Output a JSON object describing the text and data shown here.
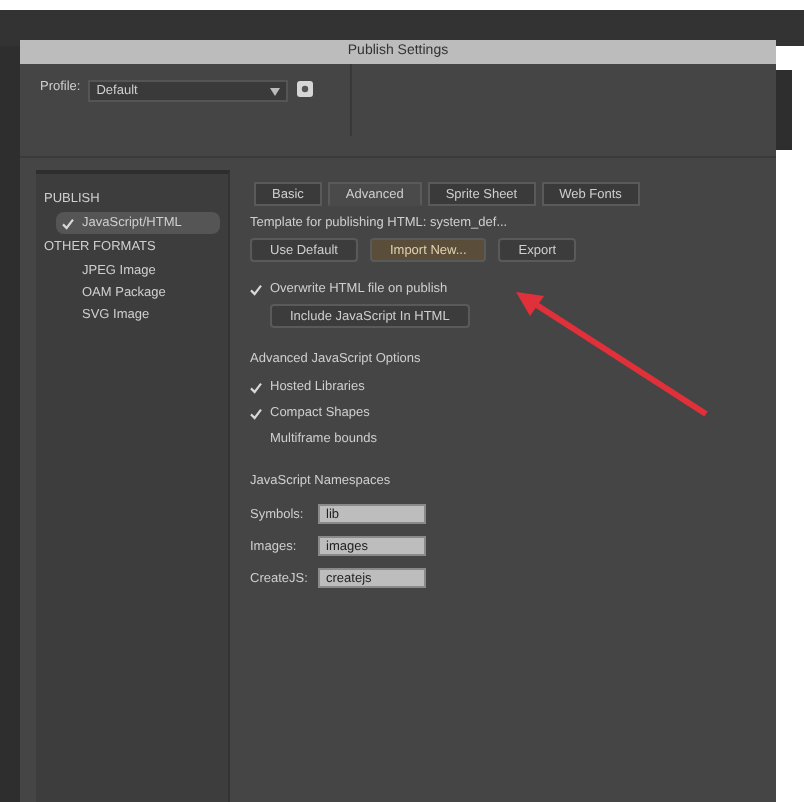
{
  "window": {
    "title": "Publish Settings"
  },
  "profile": {
    "label": "Profile:",
    "value": "Default"
  },
  "sidebar": {
    "sections": [
      {
        "title": "PUBLISH",
        "items": [
          {
            "label": "JavaScript/HTML",
            "checked": true,
            "selected": true
          }
        ]
      },
      {
        "title": "OTHER FORMATS",
        "items": [
          {
            "label": "JPEG Image",
            "checked": false,
            "selected": false
          },
          {
            "label": "OAM Package",
            "checked": false,
            "selected": false
          },
          {
            "label": "SVG Image",
            "checked": false,
            "selected": false
          }
        ]
      }
    ]
  },
  "tabs": [
    {
      "label": "Basic",
      "selected": false
    },
    {
      "label": "Advanced",
      "selected": true
    },
    {
      "label": "Sprite Sheet",
      "selected": false
    },
    {
      "label": "Web Fonts",
      "selected": false
    }
  ],
  "template_label": "Template for publishing HTML: system_def...",
  "template_buttons": [
    {
      "label": "Use Default",
      "highlighted": false
    },
    {
      "label": "Import New...",
      "highlighted": true
    },
    {
      "label": "Export",
      "highlighted": false
    }
  ],
  "overwrite": {
    "label": "Overwrite HTML file on publish",
    "checked": true
  },
  "include_button": "Include JavaScript In HTML",
  "options": {
    "title": "Advanced JavaScript Options",
    "items": [
      {
        "label": "Hosted Libraries",
        "checked": true
      },
      {
        "label": "Compact Shapes",
        "checked": true
      },
      {
        "label": "Multiframe bounds",
        "checked": false
      }
    ]
  },
  "namespaces": {
    "title": "JavaScript Namespaces",
    "fields": [
      {
        "label": "Symbols:",
        "value": "lib"
      },
      {
        "label": "Images:",
        "value": "images"
      },
      {
        "label": "CreateJS:",
        "value": "createjs"
      }
    ]
  }
}
